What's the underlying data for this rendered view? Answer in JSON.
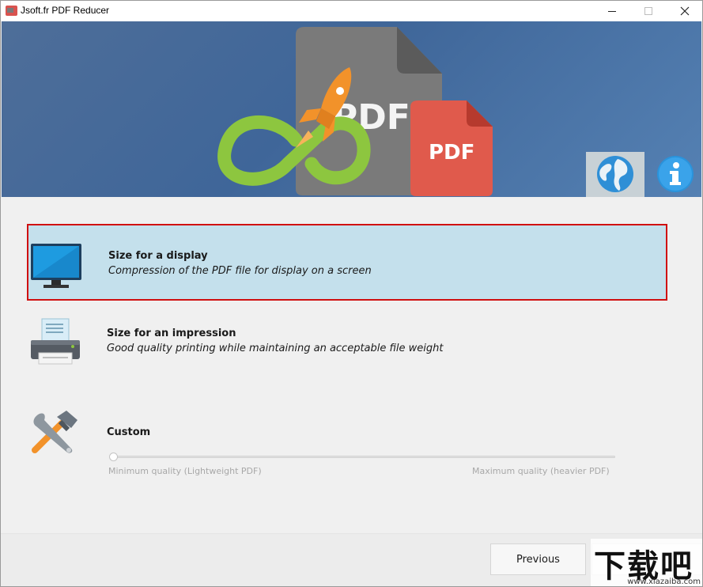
{
  "window": {
    "title": "Jsoft.fr PDF Reducer",
    "controls": {
      "minimize": "",
      "maximize": "",
      "close": "✕"
    }
  },
  "banner": {
    "pdf_large_text": "PDF",
    "pdf_small_text": "PDF",
    "colors": {
      "background": "#4a72a3",
      "gray_doc": "#777777",
      "red_doc": "#e05a4c",
      "rocket": "#f2922a",
      "loop": "#8dc63f"
    },
    "buttons": {
      "language_icon": "globe-icon",
      "about_icon": "info-icon"
    }
  },
  "options": [
    {
      "title": "Size for a display",
      "description": "Compression of the PDF file for display on a screen",
      "icon": "monitor-icon",
      "selected": true
    },
    {
      "title": "Size for an impression",
      "description": "Good quality printing while maintaining an acceptable file weight",
      "icon": "printer-icon",
      "selected": false
    },
    {
      "title": "Custom",
      "description": "",
      "icon": "tools-icon",
      "selected": false
    }
  ],
  "custom_slider": {
    "min_label": "Minimum quality (Lightweight PDF)",
    "max_label": "Maximum quality (heavier PDF)",
    "value_fraction": 0.0
  },
  "footer": {
    "previous_label": "Previous",
    "next_label": ""
  },
  "watermark": {
    "chinese_text": "下载吧",
    "url_text": "www.xiazaiba.com"
  }
}
